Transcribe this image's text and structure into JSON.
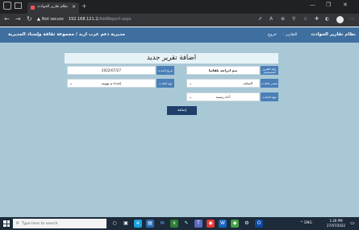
{
  "browser": {
    "tab_title": "نظام تقارير الحوادث",
    "tab_close": "×",
    "new_tab": "+",
    "address": {
      "warning_icon": "▲",
      "security": "Not secure",
      "host": "192.168.121.2",
      "path": "/AddReport.aspx"
    }
  },
  "appnav": {
    "brand": "نظام تقارير الحوادث",
    "menu_reports": "التقارير ·",
    "menu_logout": "خروج",
    "org": "مديرية دعم عرب اربد / مجموعة ثقافة وإسناد المديرية"
  },
  "form": {
    "title": "اضافة تقرير جديد",
    "fields": {
      "report_number": {
        "label": "رقم التقرير المتسلسل",
        "value": "يتم ادراجه تلقائيا"
      },
      "date": {
        "label": "تاريخ الحدث",
        "value": "2022/07/27"
      },
      "source": {
        "label": "مصدر الحادث",
        "value": "السلف"
      },
      "type": {
        "label": "نوع الحادث",
        "value": "إعتداء و تهويبة"
      },
      "sector": {
        "label": "جهة الحادث",
        "value": "أداة رئيسة"
      }
    },
    "submit": "إضافة"
  },
  "taskbar": {
    "search_placeholder": "Type here to search",
    "tray_text": "^ ENG",
    "time": "1:26 PM",
    "date": "27/07/2022"
  }
}
